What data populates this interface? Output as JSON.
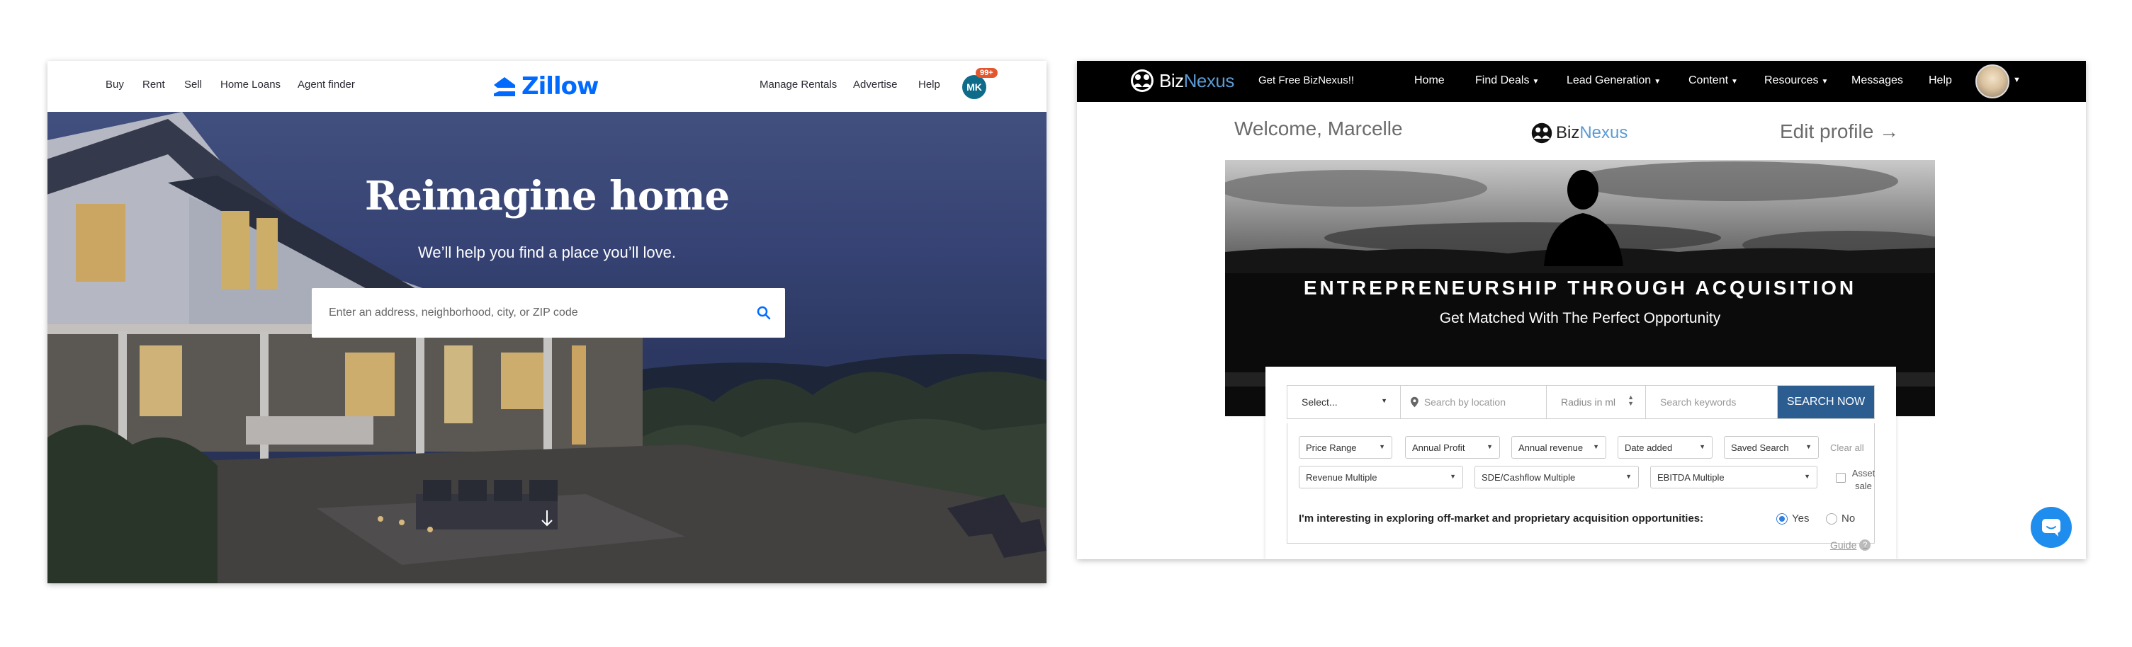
{
  "zillow": {
    "nav_left": [
      {
        "label": "Buy"
      },
      {
        "label": "Rent"
      },
      {
        "label": "Sell"
      },
      {
        "label": "Home Loans"
      },
      {
        "label": "Agent finder"
      }
    ],
    "logo_text": "Zillow",
    "nav_right": [
      {
        "label": "Manage Rentals"
      },
      {
        "label": "Advertise"
      },
      {
        "label": "Help"
      }
    ],
    "avatar_initials": "MK",
    "notification_badge": "99+",
    "headline": "Reimagine home",
    "subheadline": "We’ll help you find a place you’ll love.",
    "search_placeholder": "Enter an address, neighborhood, city, or ZIP code",
    "brand_color": "#006aff",
    "icons": [
      "search-icon",
      "arrow-down-icon",
      "zillow-logo-icon"
    ]
  },
  "biznexus": {
    "nav": {
      "logo_biz": "Biz",
      "logo_nexus": "Nexus",
      "cta": "Get Free BizNexus!!",
      "items": [
        {
          "label": "Home",
          "dropdown": false
        },
        {
          "label": "Find Deals",
          "dropdown": true
        },
        {
          "label": "Lead Generation",
          "dropdown": true
        },
        {
          "label": "Content",
          "dropdown": true
        },
        {
          "label": "Resources",
          "dropdown": true
        },
        {
          "label": "Messages",
          "dropdown": false
        },
        {
          "label": "Help",
          "dropdown": false
        }
      ]
    },
    "welcome": "Welcome, Marcelle",
    "edit_profile": "Edit profile →",
    "banner": {
      "title": "ENTREPRENEURSHIP THROUGH ACQUISITION",
      "subtitle": "Get Matched With The Perfect Opportunity"
    },
    "search": {
      "select_label": "Select...",
      "location_placeholder": "Search by location",
      "radius_label": "Radius in ml",
      "keywords_placeholder": "Search keywords",
      "button": "SEARCH NOW"
    },
    "filters": {
      "row1": [
        {
          "label": "Price Range"
        },
        {
          "label": "Annual Profit"
        },
        {
          "label": "Annual revenue"
        },
        {
          "label": "Date added"
        },
        {
          "label": "Saved Search"
        }
      ],
      "clear_all": "Clear all",
      "row2": [
        {
          "label": "Revenue Multiple"
        },
        {
          "label": "SDE/Cashflow Multiple"
        },
        {
          "label": "EBITDA Multiple"
        }
      ],
      "asset_sale": "Asset sale",
      "question": "I'm interesting in exploring off-market and proprietary acquisition opportunities:",
      "yes": "Yes",
      "no": "No",
      "selected": "Yes"
    },
    "guide": "Guide",
    "guide_icon_text": "?",
    "brand_color": "#2b5d91",
    "icons": [
      "location-pin-icon",
      "chevron-down-icon",
      "chat-icon",
      "question-icon"
    ]
  }
}
